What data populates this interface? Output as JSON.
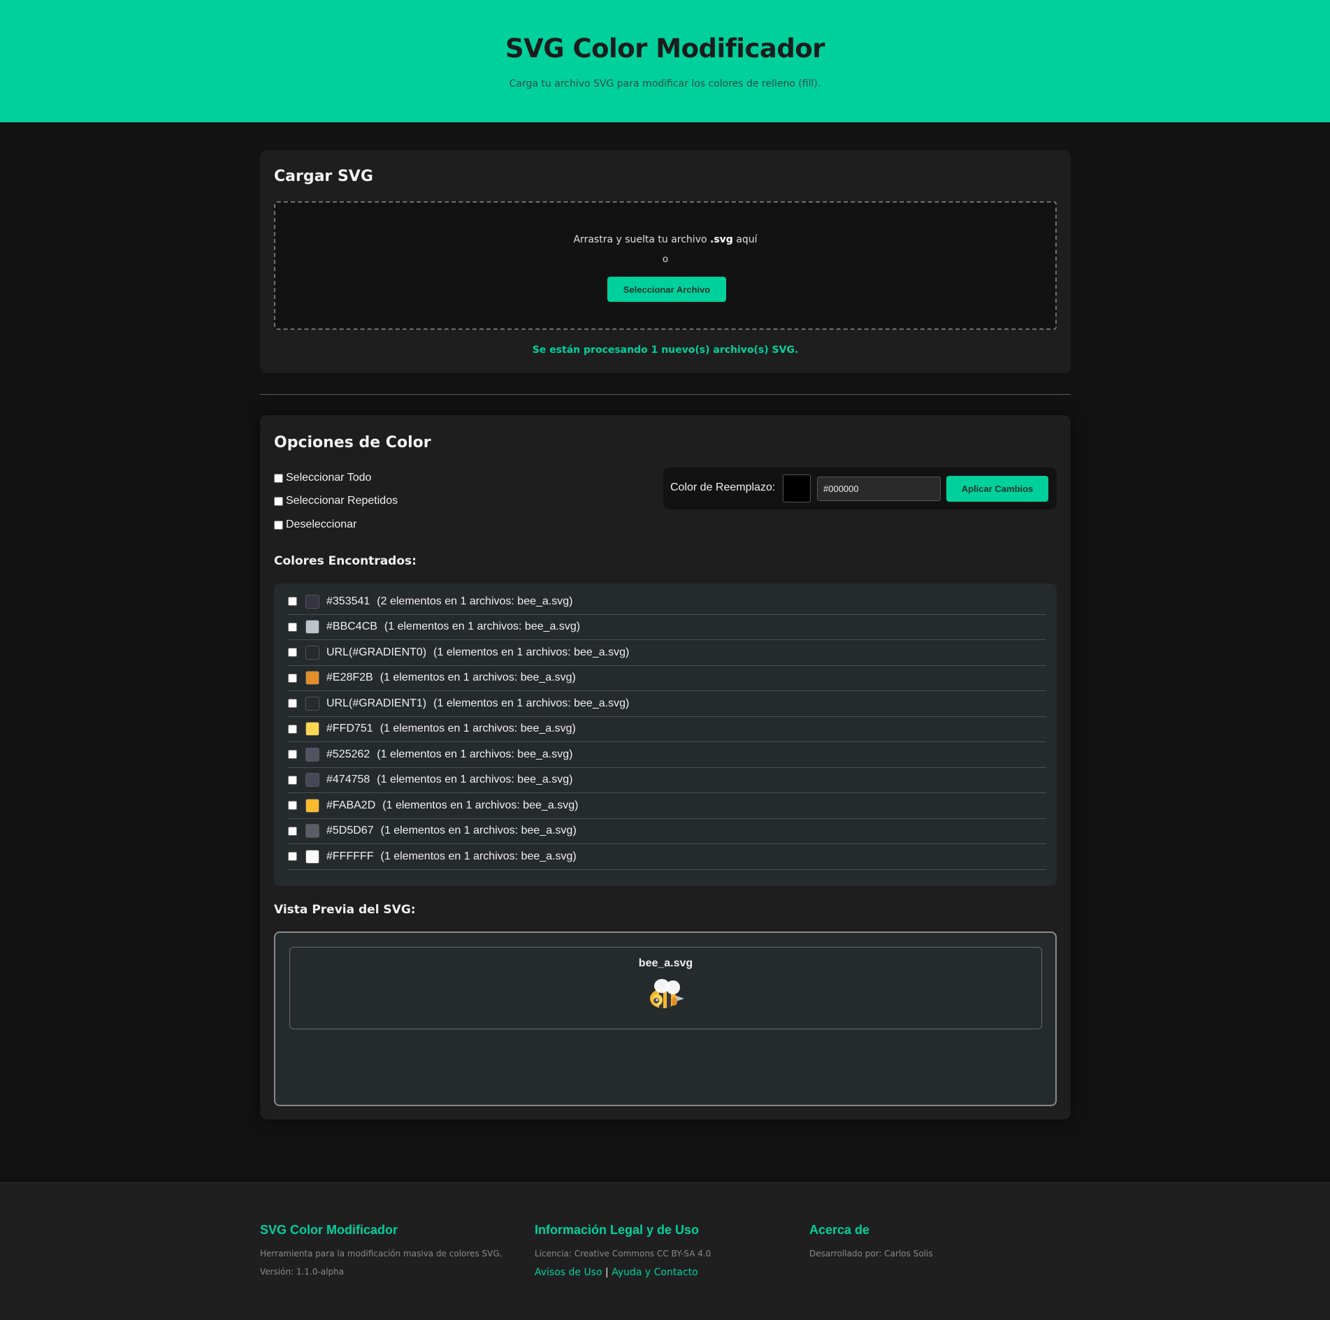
{
  "header": {
    "title": "SVG Color Modificador",
    "subtitle": "Carga tu archivo SVG para modificar los colores de relleno (fill)."
  },
  "upload": {
    "title": "Cargar SVG",
    "drop_text_prefix": "Arrastra y suelta tu archivo ",
    "drop_text_ext": ".svg",
    "drop_text_suffix": " aquí",
    "or": "o",
    "select_button": "Seleccionar Archivo",
    "status": "Se están procesando 1 nuevo(s) archivo(s) SVG."
  },
  "options": {
    "title": "Opciones de Color",
    "select_all": "Seleccionar Todo",
    "select_repeated": "Seleccionar Repetidos",
    "deselect": "Deseleccionar",
    "replace_label": "Color de Reemplazo:",
    "replace_color": "#000000",
    "replace_value": "#000000",
    "apply_button": "Aplicar Cambios",
    "found_title": "Colores Encontrados:",
    "colors": [
      {
        "hex": "#353541",
        "swatch": "#353541",
        "info": "(2 elementos en 1 archivos: bee_a.svg)"
      },
      {
        "hex": "#BBC4CB",
        "swatch": "#BBC4CB",
        "info": "(1 elementos en 1 archivos: bee_a.svg)"
      },
      {
        "hex": "URL(#GRADIENT0)",
        "swatch": "transparent",
        "info": "(1 elementos en 1 archivos: bee_a.svg)"
      },
      {
        "hex": "#E28F2B",
        "swatch": "#E28F2B",
        "info": "(1 elementos en 1 archivos: bee_a.svg)"
      },
      {
        "hex": "URL(#GRADIENT1)",
        "swatch": "transparent",
        "info": "(1 elementos en 1 archivos: bee_a.svg)"
      },
      {
        "hex": "#FFD751",
        "swatch": "#FFD751",
        "info": "(1 elementos en 1 archivos: bee_a.svg)"
      },
      {
        "hex": "#525262",
        "swatch": "#525262",
        "info": "(1 elementos en 1 archivos: bee_a.svg)"
      },
      {
        "hex": "#474758",
        "swatch": "#474758",
        "info": "(1 elementos en 1 archivos: bee_a.svg)"
      },
      {
        "hex": "#FABA2D",
        "swatch": "#FABA2D",
        "info": "(1 elementos en 1 archivos: bee_a.svg)"
      },
      {
        "hex": "#5D5D67",
        "swatch": "#5D5D67",
        "info": "(1 elementos en 1 archivos: bee_a.svg)"
      },
      {
        "hex": "#FFFFFF",
        "swatch": "#FFFFFF",
        "info": "(1 elementos en 1 archivos: bee_a.svg)"
      }
    ],
    "preview_title": "Vista Previa del SVG:",
    "preview_file": "bee_a.svg"
  },
  "footer": {
    "col1_title": "SVG Color Modificador",
    "col1_desc": "Herramienta para la modificación masiva de colores SVG.",
    "col1_version": "Versión: 1.1.0-alpha",
    "col2_title": "Información Legal y de Uso",
    "col2_license": "Licencia: Creative Commons CC BY-SA 4.0",
    "col2_link1": "Avisos de Uso",
    "col2_sep": " | ",
    "col2_link2": "Ayuda y Contacto",
    "col3_title": "Acerca de",
    "col3_author": "Desarrollado por: Carlos Solis"
  },
  "colors": {
    "accent": "#00d09c",
    "background": "#121212",
    "card": "#1e1e1e"
  }
}
